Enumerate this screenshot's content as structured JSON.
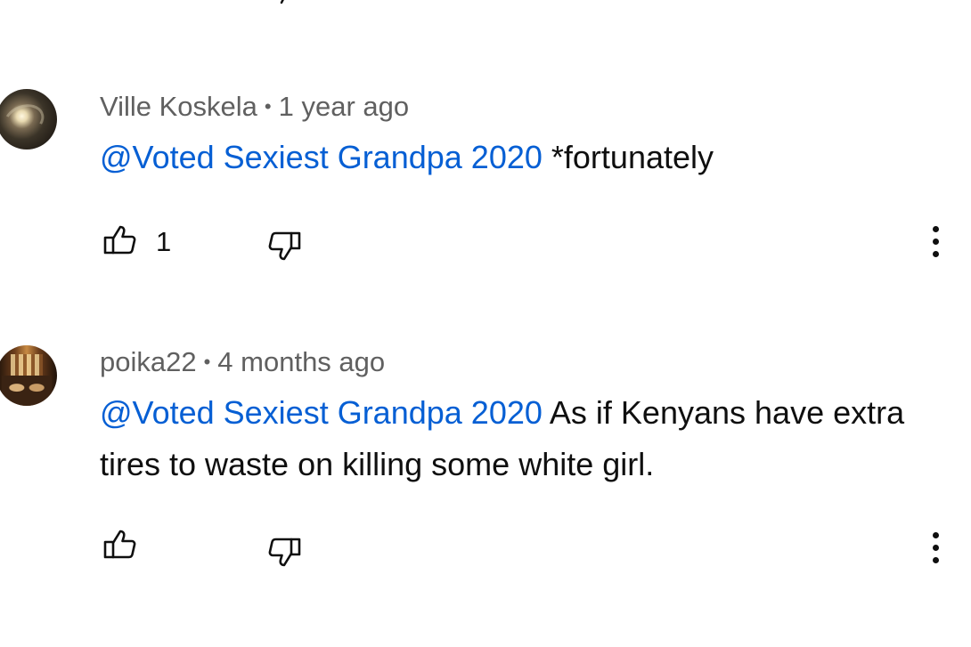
{
  "comments": [
    {
      "author": "Ville Koskela",
      "separator": "•",
      "time": "1 year ago",
      "mention": "@Voted Sexiest Grandpa 2020",
      "text": " *fortunately",
      "like_count": "1",
      "avatar_icon": "moon-eclipse-avatar"
    },
    {
      "author": "poika22",
      "separator": "•",
      "time": "4 months ago",
      "mention": "@Voted Sexiest Grandpa 2020",
      "text": " As if Kenyans have extra tires to waste on killing some white girl.",
      "like_count": "",
      "avatar_icon": "room-photo-avatar"
    }
  ],
  "icons": {
    "like": "thumbs-up-icon",
    "dislike": "thumbs-down-icon",
    "more": "more-vert-icon"
  },
  "colors": {
    "mention": "#065fd4",
    "meta": "#606060",
    "text": "#0f0f0f",
    "background": "#ffffff"
  }
}
